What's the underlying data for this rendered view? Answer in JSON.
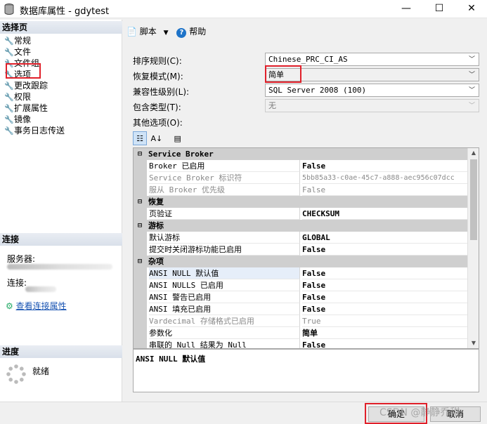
{
  "window": {
    "title": "数据库属性 - gdytest",
    "minimize": "—",
    "maximize": "☐",
    "close": "✕"
  },
  "left": {
    "select_page_header": "选择页",
    "pages": [
      "常规",
      "文件",
      "文件组",
      "选项",
      "更改跟踪",
      "权限",
      "扩展属性",
      "镜像",
      "事务日志传送"
    ],
    "connection_header": "连接",
    "server_label": "服务器:",
    "connection_label": "连接:",
    "view_conn_props": "查看连接属性",
    "progress_header": "进度",
    "progress_status": "就绪"
  },
  "toolbar": {
    "script_label": "脚本",
    "help_label": "帮助"
  },
  "form": {
    "collation_label": "排序规则(C):",
    "collation_value": "Chinese_PRC_CI_AS",
    "recovery_label": "恢复模式(M):",
    "recovery_value": "简单",
    "compat_label": "兼容性级别(L):",
    "compat_value": "SQL Server 2008 (100)",
    "containment_label": "包含类型(T):",
    "containment_value": "无",
    "other_label": "其他选项(O):"
  },
  "grid": {
    "categories": {
      "service_broker": "Service Broker",
      "recovery": "恢复",
      "cursor": "游标",
      "misc": "杂项"
    },
    "rows": {
      "broker_enabled": {
        "name": "Broker 已启用",
        "value": "False"
      },
      "broker_id": {
        "name": "Service Broker 标识符",
        "value": "5bb85a33-c0ae-45c7-a888-aec956c07dcc"
      },
      "broker_priority": {
        "name": "服从 Broker 优先级",
        "value": "False"
      },
      "page_verify": {
        "name": "页验证",
        "value": "CHECKSUM"
      },
      "default_cursor": {
        "name": "默认游标",
        "value": "GLOBAL"
      },
      "close_cursor": {
        "name": "提交时关闭游标功能已启用",
        "value": "False"
      },
      "ansi_null_default": {
        "name": "ANSI NULL 默认值",
        "value": "False"
      },
      "ansi_nulls": {
        "name": "ANSI NULLS 已启用",
        "value": "False"
      },
      "ansi_warnings": {
        "name": "ANSI 警告已启用",
        "value": "False"
      },
      "ansi_padding": {
        "name": "ANSI 填充已启用",
        "value": "False"
      },
      "vardecimal": {
        "name": "Vardecimal 存储格式已启用",
        "value": "True"
      },
      "parameterization": {
        "name": "参数化",
        "value": "简单"
      },
      "concat_null": {
        "name": "串联的 Null 结果为 Null",
        "value": "False"
      }
    }
  },
  "description": "ANSI NULL 默认值",
  "buttons": {
    "ok": "确定",
    "cancel": "取消"
  },
  "watermark": "CSDN @静静乔甜"
}
